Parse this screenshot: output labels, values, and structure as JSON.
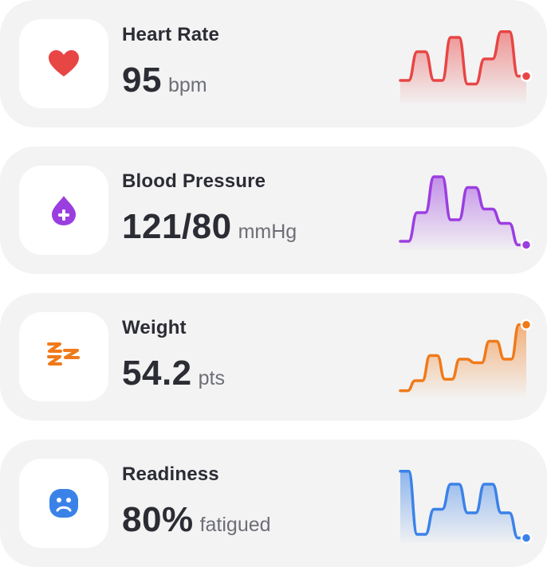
{
  "metrics": [
    {
      "title": "Heart Rate",
      "value": "95",
      "unit": "bpm",
      "icon": "heart-icon",
      "color": "#e84545",
      "trend": [
        0.3,
        0.3,
        0.7,
        0.7,
        0.3,
        0.3,
        0.9,
        0.9,
        0.25,
        0.25,
        0.6,
        0.6,
        0.98,
        0.98,
        0.36,
        0.36
      ]
    },
    {
      "title": "Blood Pressure",
      "value": "121/80",
      "unit": "mmHg",
      "icon": "blood-drop-plus-icon",
      "color": "#9b3ee0",
      "trend": [
        0.1,
        0.1,
        0.5,
        0.5,
        1.0,
        1.0,
        0.4,
        0.4,
        0.85,
        0.85,
        0.55,
        0.55,
        0.35,
        0.35,
        0.05,
        0.05
      ]
    },
    {
      "title": "Weight",
      "value": "54.2",
      "unit": "pts",
      "icon": "zigzag-icon",
      "color": "#f07a1a",
      "trend": [
        0.06,
        0.06,
        0.2,
        0.2,
        0.55,
        0.55,
        0.22,
        0.22,
        0.5,
        0.5,
        0.45,
        0.45,
        0.75,
        0.75,
        0.5,
        0.5,
        0.98,
        0.98
      ]
    },
    {
      "title": "Readiness",
      "value": "80%",
      "unit": "fatigued",
      "icon": "sad-face-icon",
      "color": "#3b82e8",
      "trend": [
        0.98,
        0.98,
        0.1,
        0.1,
        0.45,
        0.45,
        0.8,
        0.8,
        0.4,
        0.4,
        0.8,
        0.8,
        0.4,
        0.4,
        0.05,
        0.05
      ]
    }
  ]
}
